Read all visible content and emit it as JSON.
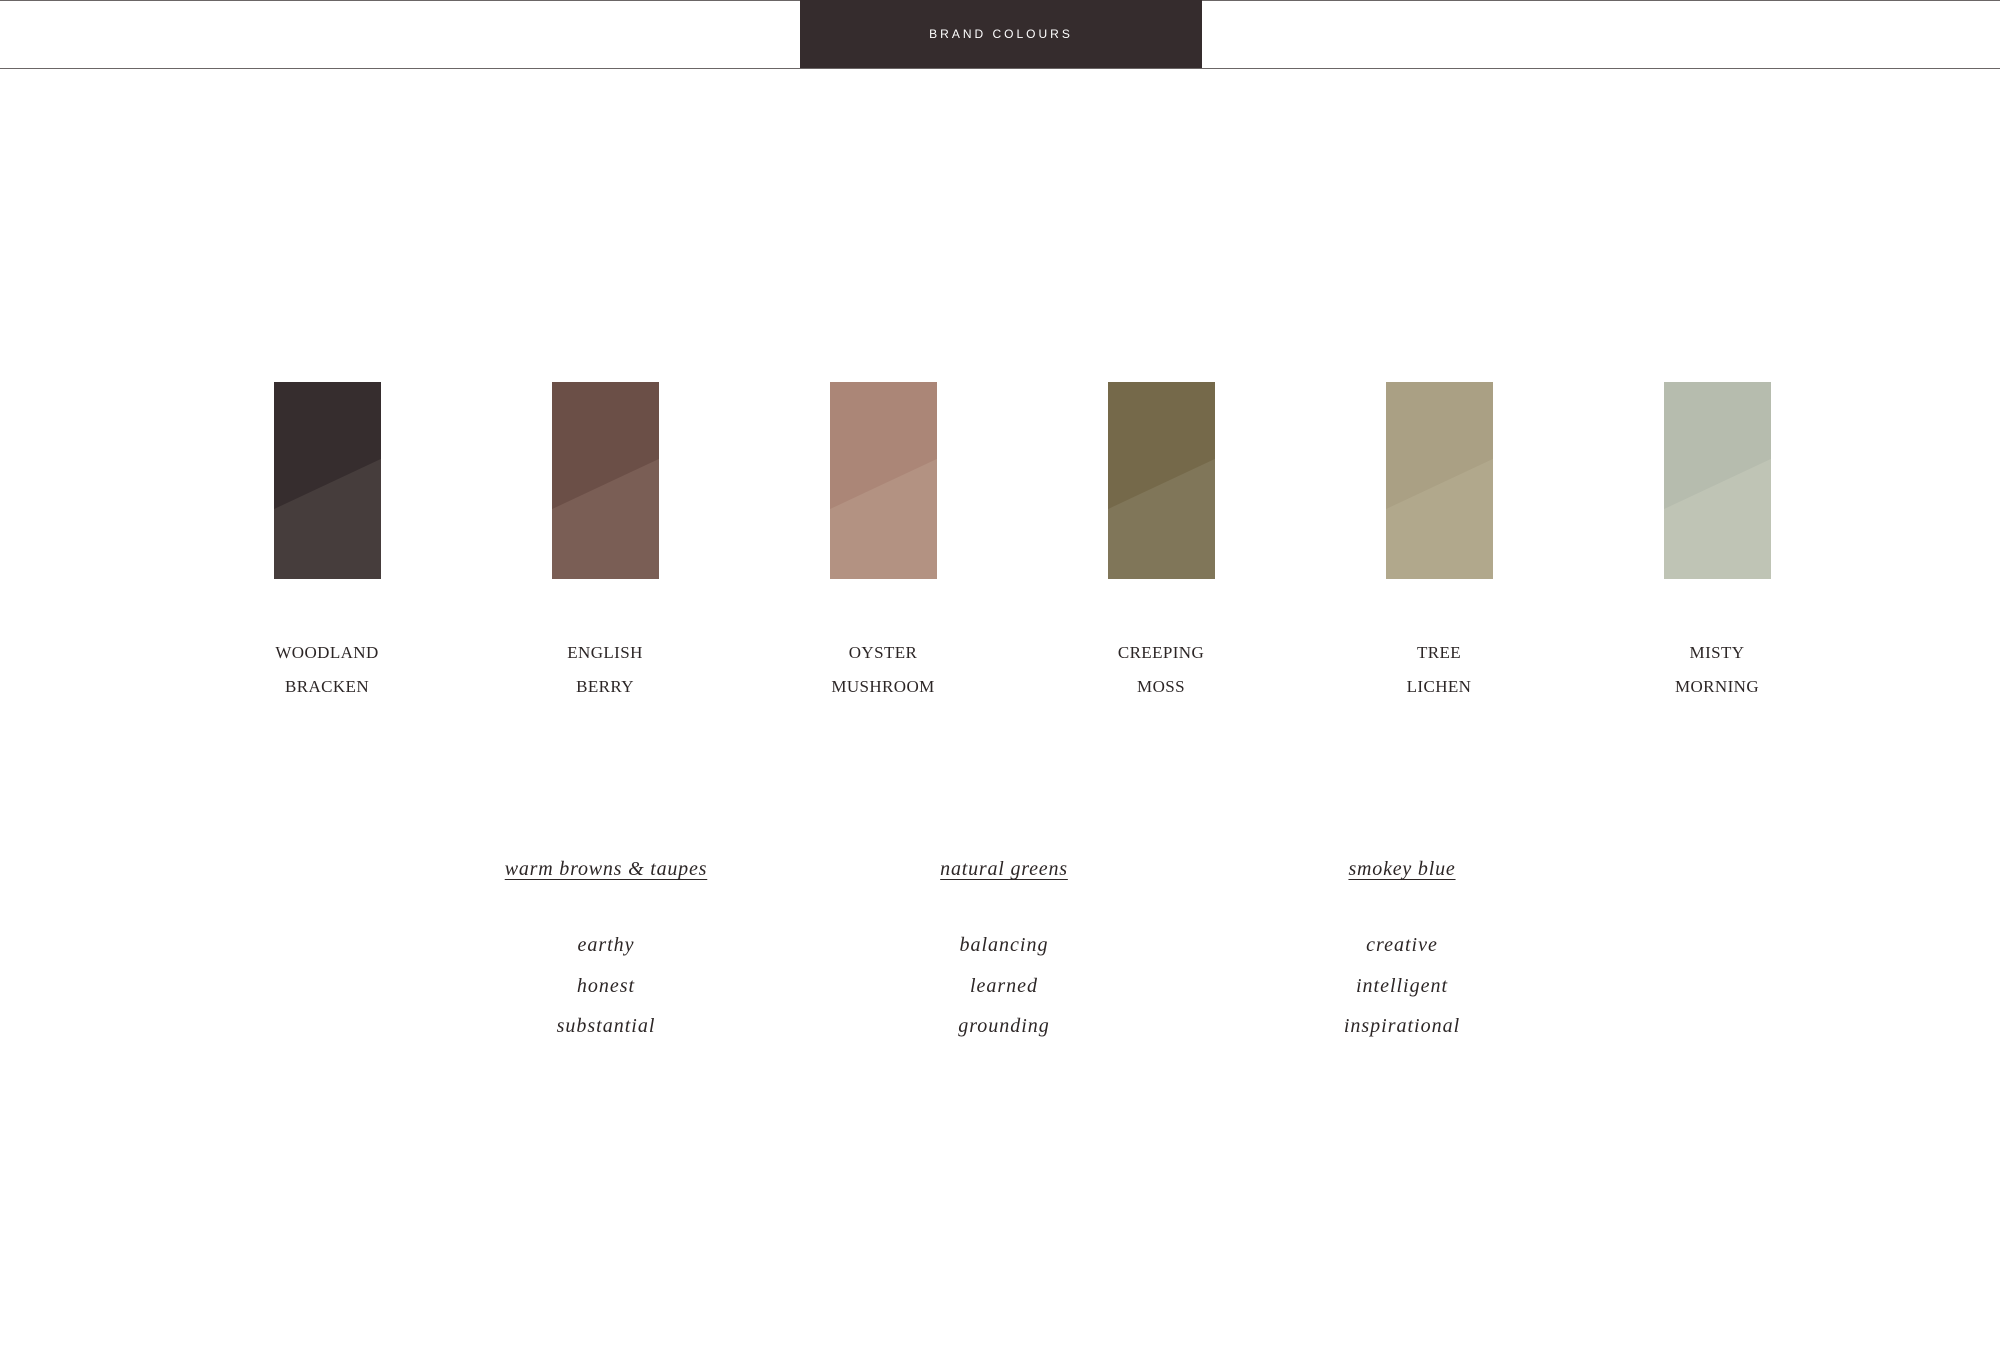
{
  "header": {
    "title": "BRAND COLOURS"
  },
  "swatches": [
    {
      "name_line1": "WOODLAND",
      "name_line2": "BRACKEN",
      "color_top": "#362d2e",
      "color_bottom": "#463d3c"
    },
    {
      "name_line1": "ENGLISH",
      "name_line2": "BERRY",
      "color_top": "#6b4f47",
      "color_bottom": "#7a5e55"
    },
    {
      "name_line1": "OYSTER",
      "name_line2": "MUSHROOM",
      "color_top": "#ab8677",
      "color_bottom": "#b39282"
    },
    {
      "name_line1": "CREEPING",
      "name_line2": "MOSS",
      "color_top": "#75694a",
      "color_bottom": "#807659"
    },
    {
      "name_line1": "TREE",
      "name_line2": "LICHEN",
      "color_top": "#aaa084",
      "color_bottom": "#b1a88c"
    },
    {
      "name_line1": "MISTY",
      "name_line2": "MORNING",
      "color_top": "#b6bcae",
      "color_bottom": "#bfc4b5"
    }
  ],
  "groups": [
    {
      "title": "warm browns & taupes",
      "words": [
        "earthy",
        "honest",
        "substantial"
      ]
    },
    {
      "title": "natural greens",
      "words": [
        "balancing",
        "learned",
        "grounding"
      ]
    },
    {
      "title": "smokey blue",
      "words": [
        "creative",
        "intelligent",
        "inspirational"
      ]
    }
  ]
}
